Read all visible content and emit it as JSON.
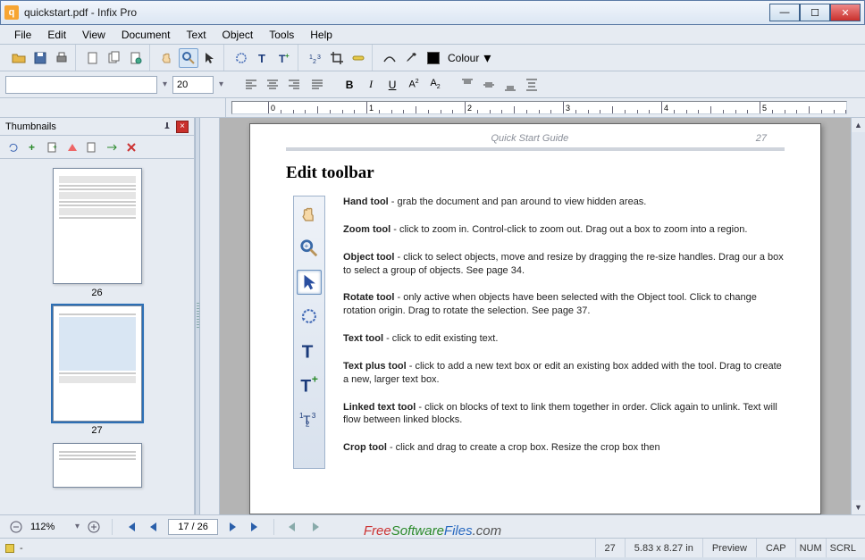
{
  "window": {
    "title": "quickstart.pdf - Infix Pro"
  },
  "menu": [
    "File",
    "Edit",
    "View",
    "Document",
    "Text",
    "Object",
    "Tools",
    "Help"
  ],
  "toolbar2": {
    "colour_label": "Colour"
  },
  "format": {
    "font": "",
    "size": "20"
  },
  "thumbnails": {
    "title": "Thumbnails",
    "pages": [
      {
        "num": "26",
        "selected": false
      },
      {
        "num": "27",
        "selected": true
      },
      {
        "num": "",
        "selected": false
      }
    ]
  },
  "page": {
    "header_title": "Quick Start Guide",
    "header_num": "27",
    "heading": "Edit toolbar",
    "items": [
      {
        "name": "Hand tool",
        "sep": " - ",
        "desc": "grab the document and pan around to view hidden areas."
      },
      {
        "name": "Zoom tool",
        "sep": " - ",
        "desc": "click to zoom in. Control-click to zoom out. Drag out a box to zoom into a region."
      },
      {
        "name": "Object tool",
        "sep": " - ",
        "desc": "click to select objects, move and resize by dragging the re-size handles. Drag our a box to select a group of objects. See page 34."
      },
      {
        "name": "Rotate tool",
        "sep": " - ",
        "desc": "only active when objects have been selected with the Object tool. Click to change rotation origin. Drag to rotate the selection. See page 37."
      },
      {
        "name": "Text tool",
        "sep": " - ",
        "desc": "click to edit existing text."
      },
      {
        "name": "Text plus tool",
        "sep": " - ",
        "desc": "click to add a new text box or edit an existing box added with the tool. Drag to create a new, larger text box."
      },
      {
        "name": "Linked text tool",
        "sep": " - ",
        "desc": "click on blocks of text to link them together in order. Click again to unlink. Text will flow between linked blocks."
      },
      {
        "name": "Crop tool",
        "sep": " - ",
        "desc": "click and drag to create a crop box. Resize the crop box then"
      }
    ]
  },
  "nav": {
    "zoom": "112%",
    "page": "17 / 26"
  },
  "status": {
    "page_count": "27",
    "dims": "5.83 x 8.27 in",
    "preview": "Preview",
    "cap": "CAP",
    "num": "NUM",
    "scrl": "SCRL"
  },
  "watermark": {
    "f": "Free",
    "s": "Software",
    "fi": "Files",
    "c": ".com"
  }
}
